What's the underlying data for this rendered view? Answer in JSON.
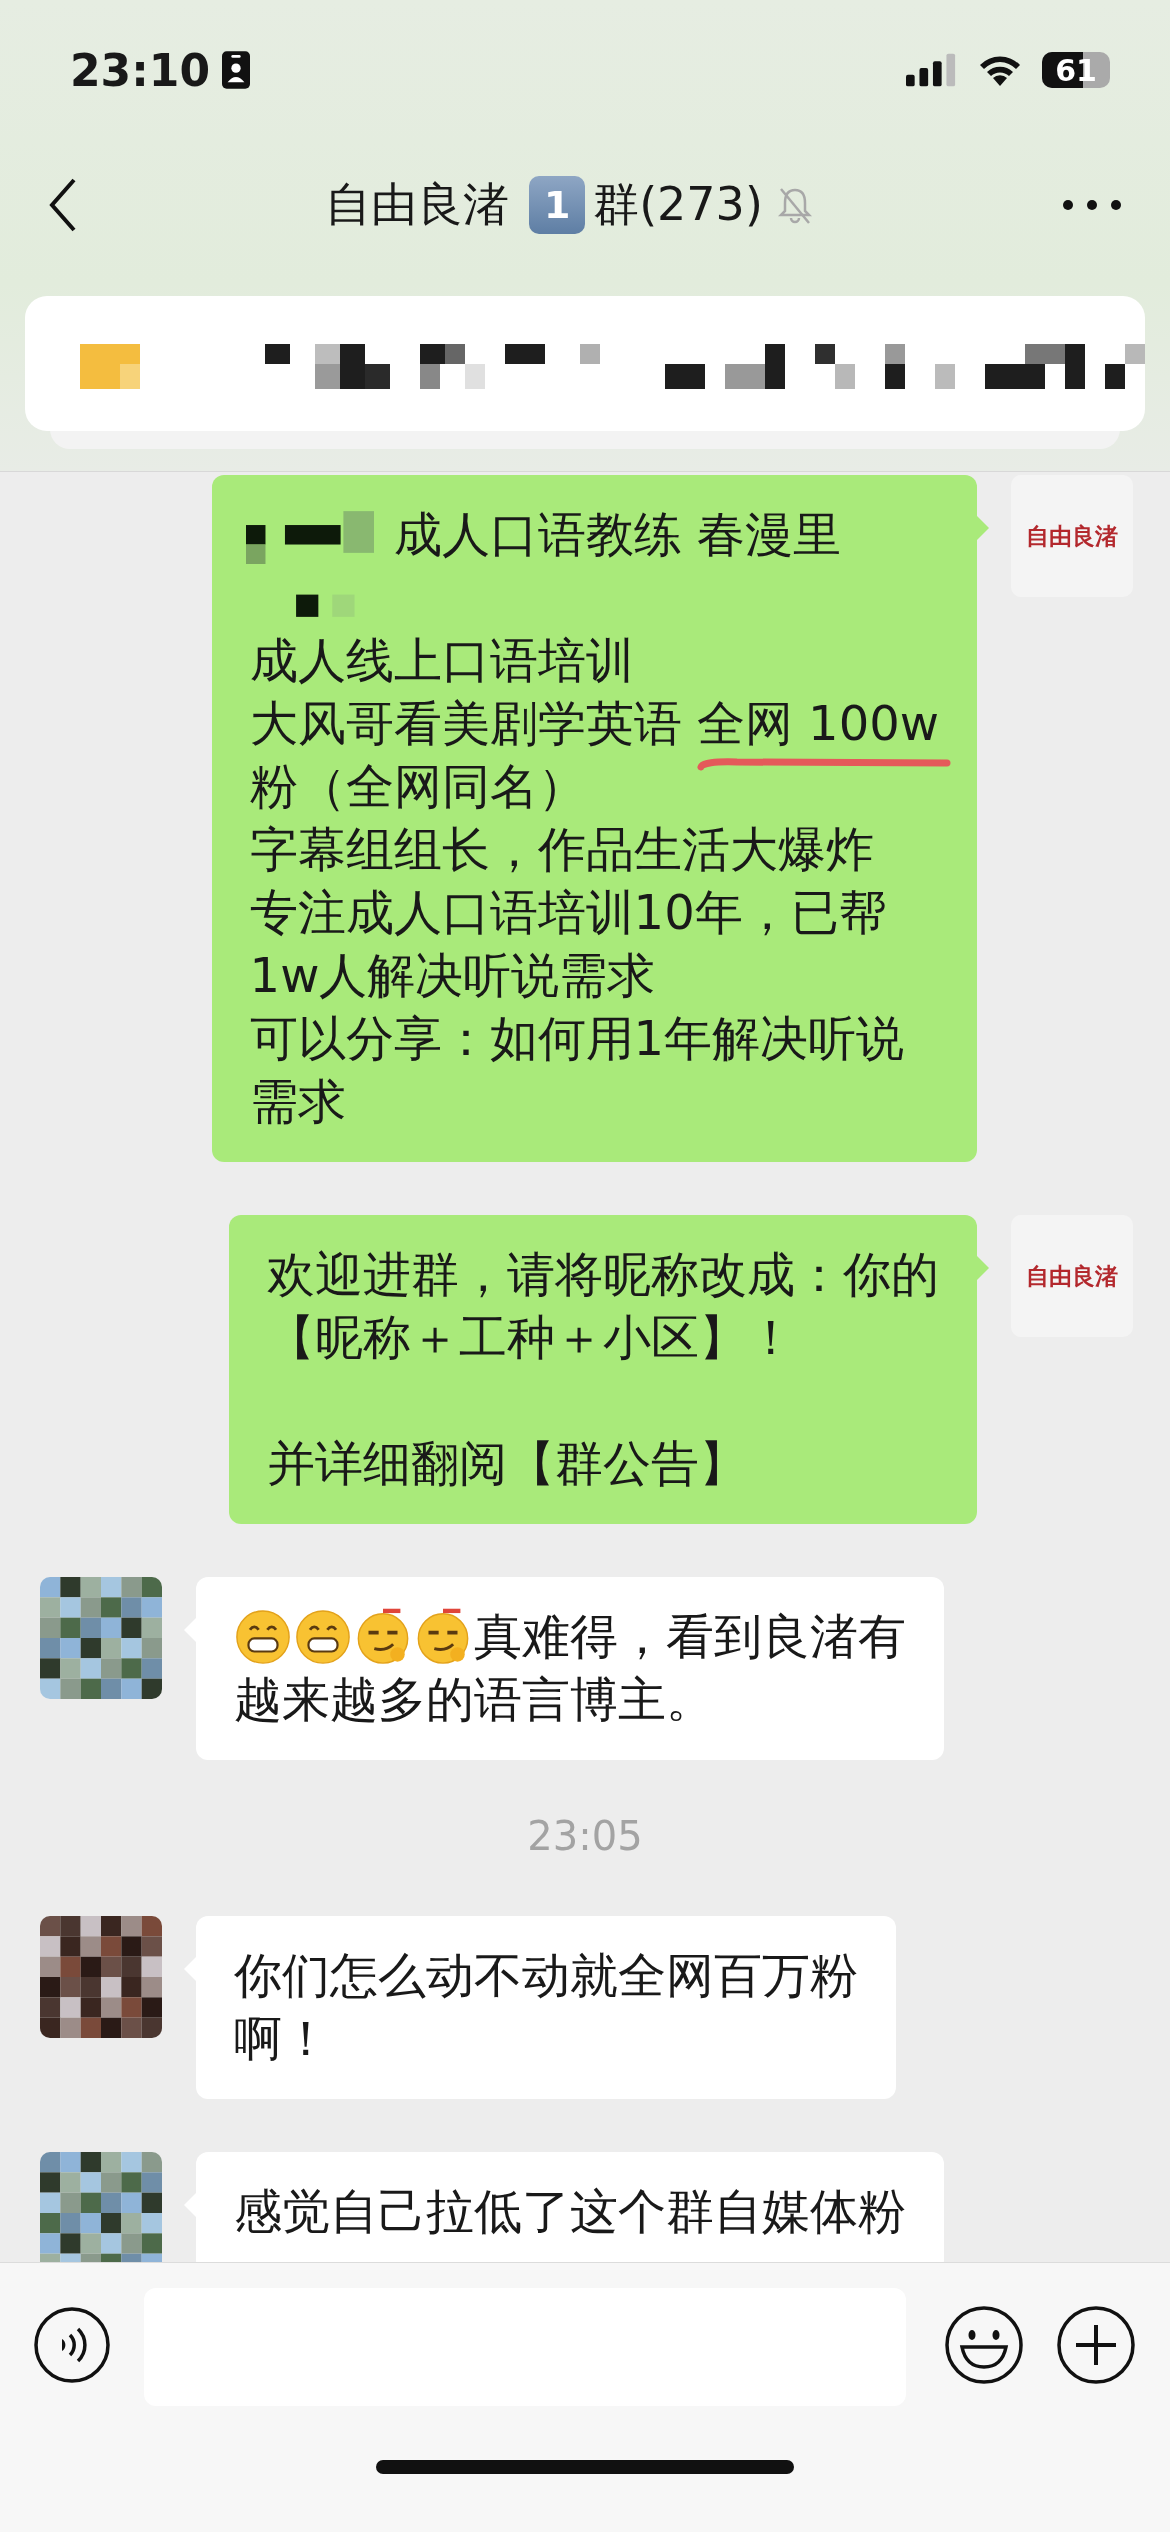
{
  "status_bar": {
    "time": "23:10",
    "battery": "61"
  },
  "nav": {
    "title": "自由良渚",
    "badge": "1",
    "suffix": "群(273)",
    "muted": true
  },
  "pinned": {
    "kind": "picture"
  },
  "messages": [
    {
      "kind": "message",
      "outgoing": true,
      "avatar": {
        "kind": "logo",
        "text": "自由良渚"
      },
      "paragraphs": [
        [
          {
            "text": "成人口语教练 春漫里",
            "obscured_prefix": true
          },
          {
            "text": "成人线上口语培训"
          },
          {
            "text": "大风哥看美剧学英语 ",
            "underlined_text": "全网 100w"
          },
          {
            "text": "粉（全网同名）"
          },
          {
            "text": "字幕组组长，作品生活大爆炸"
          },
          {
            "text": "专注成人口语培训10年，已帮"
          },
          {
            "text": "1w人解决听说需求"
          },
          {
            "text": "可以分享：如何用1年解决听说"
          },
          {
            "text": "需求"
          }
        ]
      ]
    },
    {
      "kind": "message",
      "outgoing": true,
      "avatar": {
        "kind": "logo",
        "text": "自由良渚"
      },
      "paragraphs": [
        [
          {
            "text": "欢迎进群，请将昵称改成：你的"
          },
          {
            "text": "【昵称＋工种＋小区】！"
          }
        ],
        [
          {
            "text": "并详细翻阅【群公告】"
          }
        ]
      ]
    },
    {
      "kind": "message",
      "outgoing": false,
      "avatar": {
        "kind": "picture"
      },
      "paragraphs": [
        [
          {
            "text": "真难得，看到良渚有",
            "emoji": [
              {
                "kind": "grin"
              },
              {
                "kind": "grin"
              },
              {
                "kind": "smirk"
              },
              {
                "kind": "smirk"
              }
            ]
          },
          {
            "text": "越来越多的语言博主。"
          }
        ]
      ]
    },
    {
      "kind": "time",
      "text": "23:05"
    },
    {
      "kind": "message",
      "outgoing": false,
      "avatar": {
        "kind": "picture"
      },
      "paragraphs": [
        [
          {
            "text": "你们怎么动不动就全网百万粉"
          },
          {
            "text": "啊！"
          }
        ]
      ]
    },
    {
      "kind": "message",
      "outgoing": false,
      "avatar": {
        "kind": "picture"
      },
      "paragraphs": [
        [
          {
            "text": "感觉自己拉低了这个群自媒体粉"
          }
        ]
      ]
    }
  ]
}
